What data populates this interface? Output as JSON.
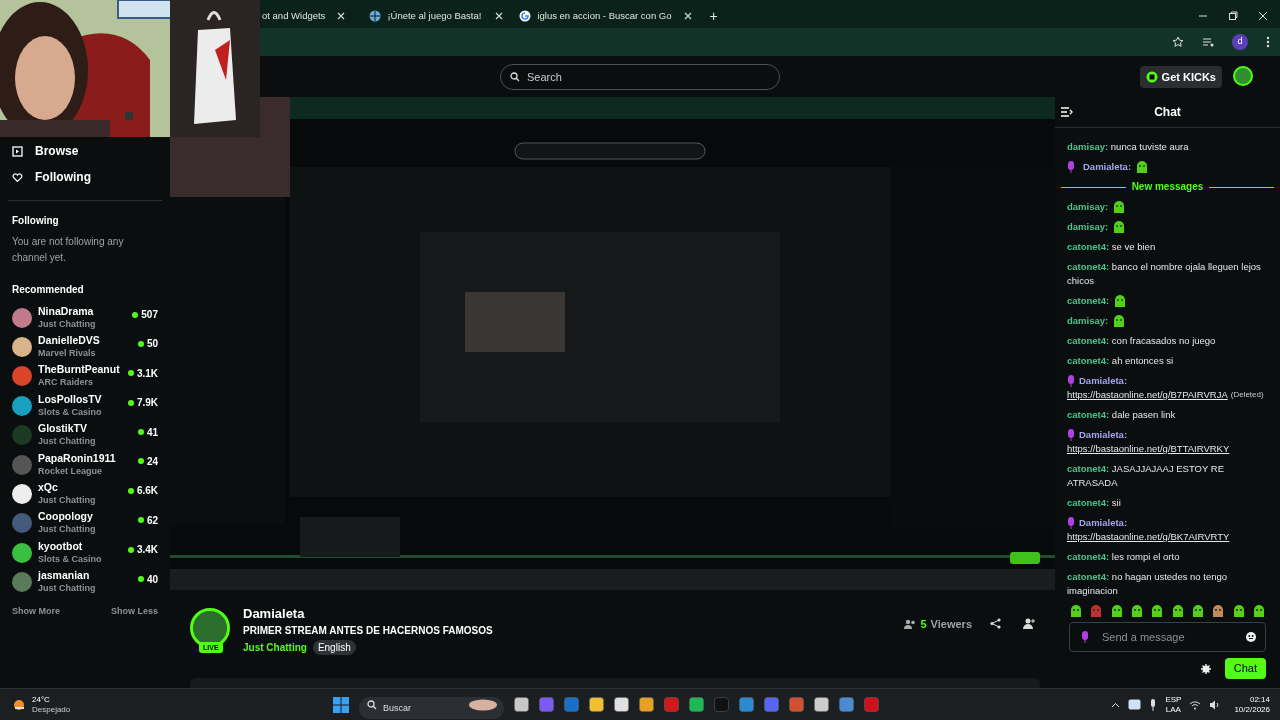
{
  "browser": {
    "tabs": [
      {
        "title": "ot and Widgets",
        "selected": false
      },
      {
        "title": "¡Únete al juego Basta!",
        "selected": false
      },
      {
        "title": "iglus en accion - Buscar con Go",
        "selected": false
      }
    ],
    "new_tab": "+",
    "profile": "d"
  },
  "header": {
    "search_placeholder": "Search",
    "get_kicks": "Get KICKs"
  },
  "sidebar": {
    "nav": [
      {
        "label": "Browse",
        "kind": "browse"
      },
      {
        "label": "Following",
        "kind": "following"
      }
    ],
    "following_title": "Following",
    "following_empty": "You are not following any channel yet.",
    "recommended_title": "Recommended",
    "channels": [
      {
        "name": "NinaDrama",
        "category": "Just Chatting",
        "viewers": "507"
      },
      {
        "name": "DanielleDVS",
        "category": "Marvel Rivals",
        "viewers": "50"
      },
      {
        "name": "TheBurntPeanut",
        "category": "ARC Raiders",
        "viewers": "3.1K"
      },
      {
        "name": "LosPollosTV",
        "category": "Slots & Casino",
        "viewers": "7.9K"
      },
      {
        "name": "GlostikTV",
        "category": "Just Chatting",
        "viewers": "41"
      },
      {
        "name": "PapaRonin1911",
        "category": "Rocket League",
        "viewers": "24"
      },
      {
        "name": "xQc",
        "category": "Just Chatting",
        "viewers": "6.6K"
      },
      {
        "name": "Coopology",
        "category": "Just Chatting",
        "viewers": "62"
      },
      {
        "name": "kyootbot",
        "category": "Slots & Casino",
        "viewers": "3.4K"
      },
      {
        "name": "jasmanian",
        "category": "Just Chatting",
        "viewers": "40"
      }
    ],
    "show_more": "Show More",
    "show_less": "Show Less"
  },
  "stream": {
    "channel": "Damialeta",
    "live_badge": "LIVE",
    "title": "PRIMER STREAM ANTES DE HACERNOS FAMOSOS",
    "category": "Just Chatting",
    "language": "English",
    "viewer_count": "5",
    "viewers_label": "Viewers"
  },
  "chat": {
    "title": "Chat",
    "messages": [
      {
        "kind": "text",
        "user": "damisay:",
        "color": "#4cc38a",
        "host": false,
        "text": "nunca tuviste aura"
      },
      {
        "kind": "emote",
        "user": "Damialeta:",
        "color": "#a3a6ef",
        "host": true
      },
      {
        "kind": "divider",
        "text": "New messages"
      },
      {
        "kind": "emote",
        "user": "damisay:",
        "color": "#4cc38a",
        "host": false
      },
      {
        "kind": "emote",
        "user": "damisay:",
        "color": "#4cc38a",
        "host": false
      },
      {
        "kind": "text",
        "user": "catonet4:",
        "color": "#4cc38a",
        "host": false,
        "text": "se ve bien"
      },
      {
        "kind": "text",
        "user": "catonet4:",
        "color": "#4cc38a",
        "host": false,
        "text": "banco el nombre ojala lleguen lejos chicos"
      },
      {
        "kind": "emote",
        "user": "catonet4:",
        "color": "#4cc38a",
        "host": false
      },
      {
        "kind": "emote",
        "user": "damisay:",
        "color": "#4cc38a",
        "host": false
      },
      {
        "kind": "text",
        "user": "catonet4:",
        "color": "#4cc38a",
        "host": false,
        "text": "con fracasados no juego"
      },
      {
        "kind": "text",
        "user": "catonet4:",
        "color": "#4cc38a",
        "host": false,
        "text": "ah entonces si"
      },
      {
        "kind": "link",
        "user": "Damialeta:",
        "color": "#a3a6ef",
        "host": true,
        "text": "https://bastaonline.net/g/B7PAIRVRJA",
        "note": "(Deleted)"
      },
      {
        "kind": "text",
        "user": "catonet4:",
        "color": "#4cc38a",
        "host": false,
        "text": "dale pasen link"
      },
      {
        "kind": "link",
        "user": "Damialeta:",
        "color": "#a3a6ef",
        "host": true,
        "text": "https://bastaonline.net/g/BTTAIRVRKY"
      },
      {
        "kind": "text",
        "user": "catonet4:",
        "color": "#4cc38a",
        "host": false,
        "text": "JASAJJAJAAJ ESTOY RE ATRASADA"
      },
      {
        "kind": "text",
        "user": "catonet4:",
        "color": "#4cc38a",
        "host": false,
        "text": "sii"
      },
      {
        "kind": "link",
        "user": "Damialeta:",
        "color": "#a3a6ef",
        "host": true,
        "text": "https://bastaonline.net/g/BK7AIRVRTY"
      },
      {
        "kind": "text",
        "user": "catonet4:",
        "color": "#4cc38a",
        "host": false,
        "text": "les rompi el orto"
      },
      {
        "kind": "text",
        "user": "catonet4:",
        "color": "#4cc38a",
        "host": false,
        "text": "no hagan ustedes no tengo imaginacion"
      }
    ],
    "input_placeholder": "Send a message",
    "send_button": "Chat"
  },
  "taskbar": {
    "temperature": "24°C",
    "weather": "Despejado",
    "search_placeholder": "Buscar",
    "language": "ESP",
    "layout": "LAA",
    "time": "02:14",
    "date": "10/2/2026"
  }
}
